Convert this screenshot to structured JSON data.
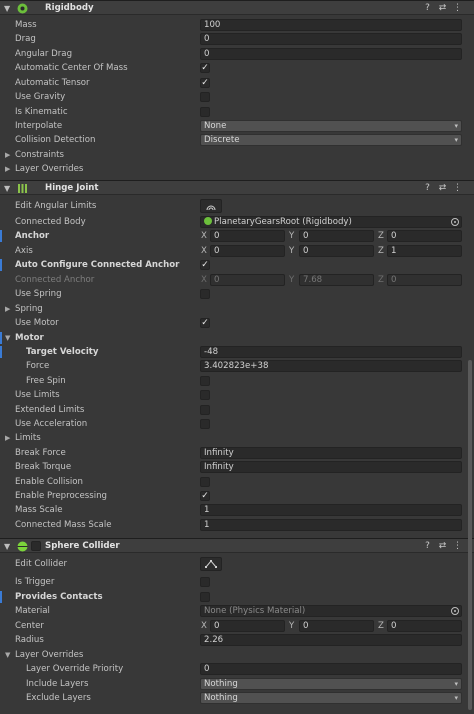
{
  "rigidbody": {
    "title": "Rigidbody",
    "mass": {
      "label": "Mass",
      "value": "100"
    },
    "drag": {
      "label": "Drag",
      "value": "0"
    },
    "angular_drag": {
      "label": "Angular Drag",
      "value": "0"
    },
    "auto_com": {
      "label": "Automatic Center Of Mass",
      "checked": true
    },
    "auto_tensor": {
      "label": "Automatic Tensor",
      "checked": true
    },
    "use_gravity": {
      "label": "Use Gravity",
      "checked": false
    },
    "is_kinematic": {
      "label": "Is Kinematic",
      "checked": false
    },
    "interpolate": {
      "label": "Interpolate",
      "value": "None"
    },
    "collision_detection": {
      "label": "Collision Detection",
      "value": "Discrete"
    },
    "constraints": {
      "label": "Constraints"
    },
    "layer_overrides": {
      "label": "Layer Overrides"
    }
  },
  "hinge": {
    "title": "Hinge Joint",
    "edit_limits": {
      "label": "Edit Angular Limits"
    },
    "connected_body": {
      "label": "Connected Body",
      "value": "PlanetaryGearsRoot (Rigidbody)"
    },
    "anchor": {
      "label": "Anchor",
      "x": "0",
      "y": "0",
      "z": "0"
    },
    "axis": {
      "label": "Axis",
      "x": "0",
      "y": "0",
      "z": "1"
    },
    "auto_configure": {
      "label": "Auto Configure Connected Anchor",
      "checked": true
    },
    "connected_anchor": {
      "label": "Connected Anchor",
      "x": "0",
      "y": "7.68",
      "z": "0"
    },
    "use_spring": {
      "label": "Use Spring",
      "checked": false
    },
    "spring": {
      "label": "Spring"
    },
    "use_motor": {
      "label": "Use Motor",
      "checked": true
    },
    "motor": {
      "label": "Motor",
      "target_velocity": {
        "label": "Target Velocity",
        "value": "-48"
      },
      "force": {
        "label": "Force",
        "value": "3.402823e+38"
      },
      "free_spin": {
        "label": "Free Spin",
        "checked": false
      }
    },
    "use_limits": {
      "label": "Use Limits",
      "checked": false
    },
    "extended_limits": {
      "label": "Extended Limits",
      "checked": false
    },
    "use_acceleration": {
      "label": "Use Acceleration",
      "checked": false
    },
    "limits": {
      "label": "Limits"
    },
    "break_force": {
      "label": "Break Force",
      "value": "Infinity"
    },
    "break_torque": {
      "label": "Break Torque",
      "value": "Infinity"
    },
    "enable_collision": {
      "label": "Enable Collision",
      "checked": false
    },
    "enable_preprocessing": {
      "label": "Enable Preprocessing",
      "checked": true
    },
    "mass_scale": {
      "label": "Mass Scale",
      "value": "1"
    },
    "connected_mass_scale": {
      "label": "Connected Mass Scale",
      "value": "1"
    }
  },
  "sphere": {
    "title": "Sphere Collider",
    "edit_collider": {
      "label": "Edit Collider"
    },
    "is_trigger": {
      "label": "Is Trigger",
      "checked": false
    },
    "provides_contacts": {
      "label": "Provides Contacts",
      "checked": false
    },
    "material": {
      "label": "Material",
      "value": "None (Physics Material)"
    },
    "center": {
      "label": "Center",
      "x": "0",
      "y": "0",
      "z": "0"
    },
    "radius": {
      "label": "Radius",
      "value": "2.26"
    },
    "layer_overrides": {
      "label": "Layer Overrides",
      "priority": {
        "label": "Layer Override Priority",
        "value": "0"
      },
      "include": {
        "label": "Include Layers",
        "value": "Nothing"
      },
      "exclude": {
        "label": "Exclude Layers",
        "value": "Nothing"
      }
    }
  },
  "axes": {
    "x": "X",
    "y": "Y",
    "z": "Z"
  },
  "icons": {
    "help": "?",
    "settings": "⇄",
    "more": "⋮",
    "fold": "▼",
    "expand": "▶",
    "check": "✓",
    "dropdown": "▾"
  },
  "colors": {
    "accent_bar": "#3a7bd5",
    "rigidbody_icon": "#6cbf3b",
    "hinge_icon": "#8bc34a",
    "collider_icon": "#7bd33b"
  }
}
